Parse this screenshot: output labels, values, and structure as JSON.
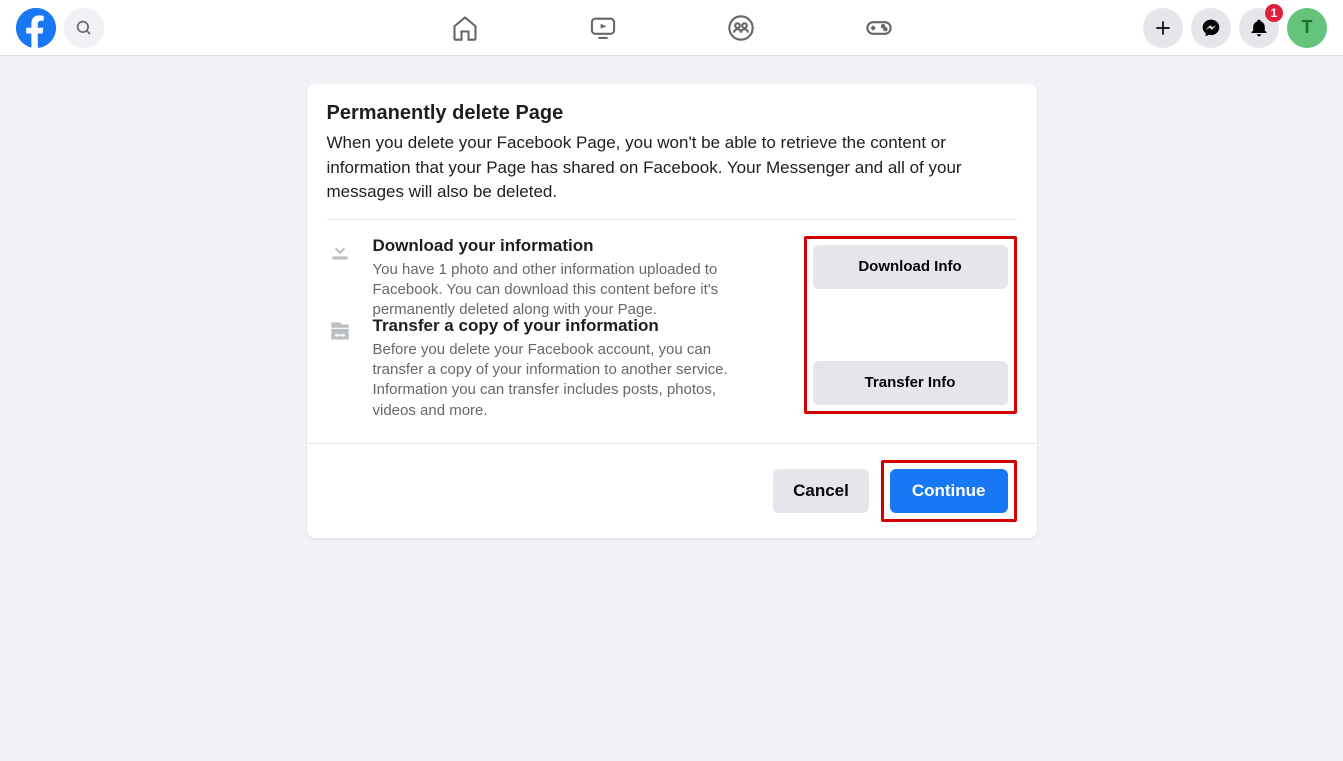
{
  "topbar": {
    "notification_count": "1",
    "avatar_initial": "T"
  },
  "dialog": {
    "title": "Permanently delete Page",
    "description": "When you delete your Facebook Page, you won't be able to retrieve the content or information that your Page has shared on Facebook. Your Messenger and all of your messages will also be deleted.",
    "options": {
      "download": {
        "title": "Download your information",
        "description": "You have 1 photo and other information uploaded to Facebook. You can download this content before it's permanently deleted along with your Page.",
        "button_label": "Download Info"
      },
      "transfer": {
        "title": "Transfer a copy of your information",
        "description": "Before you delete your Facebook account, you can transfer a copy of your information to another service. Information you can transfer includes posts, photos, videos and more.",
        "button_label": "Transfer Info"
      }
    },
    "cancel_label": "Cancel",
    "continue_label": "Continue"
  }
}
